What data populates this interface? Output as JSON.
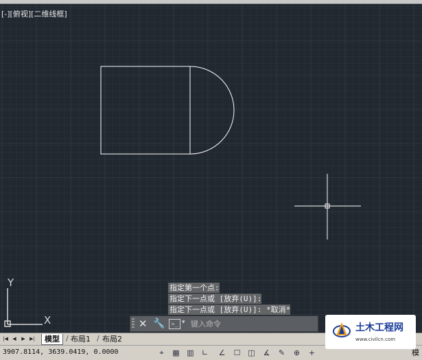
{
  "viewport": {
    "label": "[-][俯视][二维线框]",
    "axis_y_label": "Y",
    "axis_x_label": "X"
  },
  "command": {
    "history": [
      "指定第一个点:",
      "指定下一点或 [放弃(U)]:",
      "指定下一点或 [放弃(U)]: *取消*"
    ],
    "placeholder": "键入命令",
    "close_glyph": "✕",
    "wrench_glyph": "🔧",
    "prompt_glyph": ">_",
    "caret_glyph": "▾"
  },
  "tabs": {
    "nav": [
      "|◀",
      "◀",
      "▶",
      "▶|"
    ],
    "items": [
      "模型",
      "布局1",
      "布局2"
    ]
  },
  "status": {
    "coords": "3907.8114, 3639.0419, 0.0000",
    "buttons": [
      "⌖",
      "▦",
      "▥",
      "∟",
      "∠",
      "☐",
      "◫",
      "∡",
      "✎",
      "⊕",
      "+"
    ]
  },
  "watermark": {
    "name": "土木工程网",
    "url": "www.civilcn.com"
  },
  "model_button_cut": "模",
  "colors": {
    "canvas": "#212830",
    "geometry": "#ffffff",
    "ucs": "#d8d8d8"
  }
}
